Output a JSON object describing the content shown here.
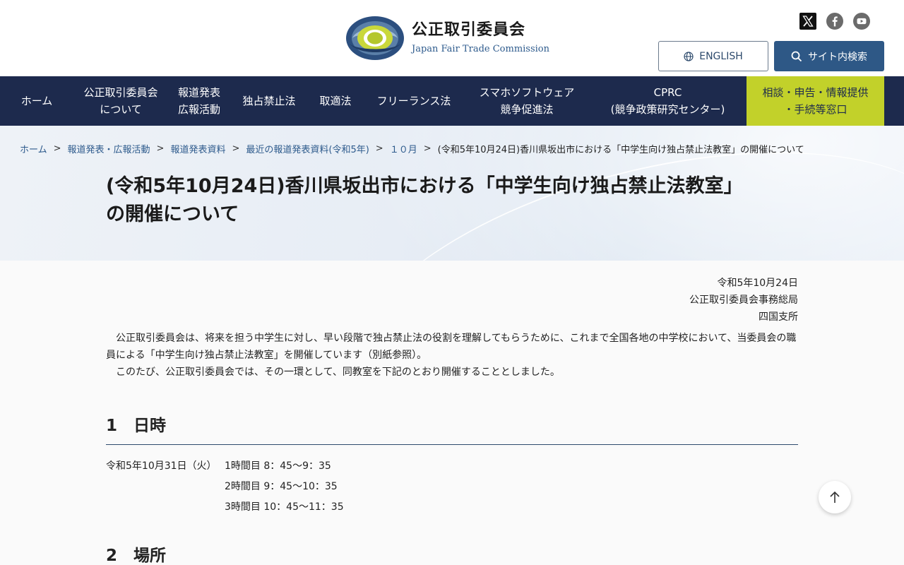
{
  "header": {
    "logo_title": "公正取引委員会",
    "logo_subtitle": "Japan Fair Trade Commission",
    "english_label": "ENGLISH",
    "search_label": "サイト内検索"
  },
  "nav": {
    "home": "ホーム",
    "about_1": "公正取引委員会",
    "about_2": "について",
    "press_1": "報道発表",
    "press_2": "広報活動",
    "antimonopoly": "独占禁止法",
    "subcontract": "取適法",
    "freelance": "フリーランス法",
    "smartphone_1": "スマホソフトウェア",
    "smartphone_2": "競争促進法",
    "cprc_1": "CPRC",
    "cprc_2": "(競争政策研究センター)",
    "consult_1": "相談・申告・情報提供",
    "consult_2": "・手続等窓口"
  },
  "breadcrumb": {
    "items": [
      "ホーム",
      "報道発表・広報活動",
      "報道発表資料",
      "最近の報道発表資料(令和5年)",
      "１０月"
    ],
    "current": "(令和5年10月24日)香川県坂出市における「中学生向け独占禁止法教室」の開催について",
    "separator": ">"
  },
  "page": {
    "title_line1": "(令和5年10月24日)香川県坂出市における「中学生向け独占禁止法教室」",
    "title_line2": "の開催について"
  },
  "meta": {
    "date": "令和5年10月24日",
    "org": "公正取引委員会事務総局",
    "office": "四国支所"
  },
  "body": {
    "para1": "公正取引委員会は、将来を担う中学生に対し、早い段階で独占禁止法の役割を理解してもらうために、これまで全国各地の中学校において、当委員会の職員による「中学生向け独占禁止法教室」を開催しています（別紙参照）。",
    "para2": "このたび、公正取引委員会では、その一環として、同教室を下記のとおり開催することとしました。"
  },
  "section1": {
    "heading": "1　日時",
    "date": "令和5年10月31日（火）",
    "slots": [
      "1時間目 8：45～9：35",
      "2時間目 9：45～10：35",
      "3時間目 10：45～11：35"
    ]
  },
  "section2": {
    "heading": "2　場所"
  },
  "colors": {
    "nav_bg": "#1d2a4d",
    "consult_bg": "#c2d12a",
    "search_btn": "#2e5886",
    "link": "#2d5a8c"
  }
}
